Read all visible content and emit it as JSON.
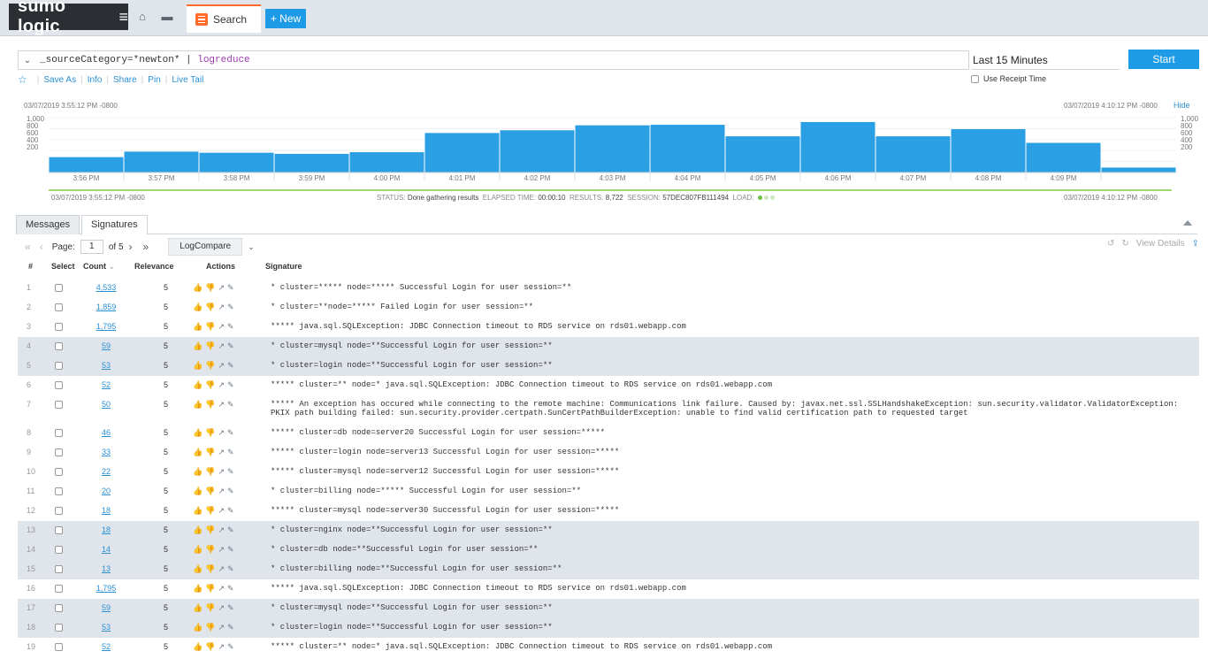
{
  "topbar": {
    "logo": "sumo logic",
    "search_tab": "Search",
    "new_button": "+ New"
  },
  "query": {
    "text": "_sourceCategory=*newton* | ",
    "keyword": "logreduce",
    "time_range": "Last 15 Minutes",
    "start_button": "Start",
    "use_receipt_time": "Use Receipt Time"
  },
  "actions": {
    "save_as": "Save As",
    "info": "Info",
    "share": "Share",
    "pin": "Pin",
    "live_tail": "Live Tail"
  },
  "histogram": {
    "ts_start": "03/07/2019 3:55:12 PM -0800",
    "ts_end": "03/07/2019 4:10:12 PM -0800",
    "hide": "Hide",
    "y_ticks": [
      "1,000",
      "800",
      "600",
      "400",
      "200"
    ],
    "time_labels": [
      "3:56 PM",
      "3:57 PM",
      "3:58 PM",
      "3:59 PM",
      "4:00 PM",
      "4:01 PM",
      "4:02 PM",
      "4:03 PM",
      "4:04 PM",
      "4:05 PM",
      "4:06 PM",
      "4:07 PM",
      "4:08 PM",
      "4:09 PM"
    ],
    "values": [
      280,
      380,
      360,
      340,
      370,
      720,
      770,
      860,
      870,
      660,
      920,
      660,
      790,
      540,
      90
    ]
  },
  "status": {
    "status_label": "STATUS:",
    "status_value": "Done gathering results",
    "elapsed_label": "ELAPSED TIME:",
    "elapsed_value": "00:00:10",
    "results_label": "RESULTS:",
    "results_value": "8,722",
    "session_label": "SESSION:",
    "session_value": "57DEC807FB111494",
    "load_label": "LOAD:"
  },
  "tabs": {
    "messages": "Messages",
    "signatures": "Signatures"
  },
  "pager": {
    "page_label": "Page:",
    "page_value": "1",
    "of_label": "of 5",
    "logcompare": "LogCompare",
    "view_details": "View Details"
  },
  "columns": {
    "num": "#",
    "select": "Select",
    "count": "Count",
    "relevance": "Relevance",
    "actions": "Actions",
    "signature": "Signature"
  },
  "rows": [
    {
      "n": "1",
      "count": "4,533",
      "rel": "5",
      "sig": "* cluster=***** node=***** Successful Login for user session=**",
      "hl": false
    },
    {
      "n": "2",
      "count": "1,859",
      "rel": "5",
      "sig": "* cluster=**node=***** Failed Login for user session=**",
      "hl": false
    },
    {
      "n": "3",
      "count": "1,795",
      "rel": "5",
      "sig": "***** java.sql.SQLException: JDBC Connection timeout to RDS service on rds01.webapp.com",
      "hl": false
    },
    {
      "n": "4",
      "count": "59",
      "rel": "5",
      "sig": "* cluster=mysql node=**Successful Login for user session=**",
      "hl": true
    },
    {
      "n": "5",
      "count": "53",
      "rel": "5",
      "sig": "* cluster=login node=**Successful Login for user session=**",
      "hl": true
    },
    {
      "n": "6",
      "count": "52",
      "rel": "5",
      "sig": "***** cluster=** node=* java.sql.SQLException: JDBC Connection timeout to RDS service on rds01.webapp.com",
      "hl": false
    },
    {
      "n": "7",
      "count": "50",
      "rel": "5",
      "sig": "***** An exception has occured while connecting to the remote machine: Communications link failure. Caused by: javax.net.ssl.SSLHandshakeException: sun.security.validator.ValidatorException: PKIX path building failed: sun.security.provider.certpath.SunCertPathBuilderException: unable to find valid certification path to requested target",
      "hl": false,
      "tall": true
    },
    {
      "n": "8",
      "count": "46",
      "rel": "5",
      "sig": "***** cluster=db node=server20 Successful Login for user session=*****",
      "hl": false
    },
    {
      "n": "9",
      "count": "33",
      "rel": "5",
      "sig": "***** cluster=login node=server13 Successful Login for user session=*****",
      "hl": false
    },
    {
      "n": "10",
      "count": "22",
      "rel": "5",
      "sig": "***** cluster=mysql node=server12 Successful Login for user session=*****",
      "hl": false
    },
    {
      "n": "11",
      "count": "20",
      "rel": "5",
      "sig": "* cluster=billing node=***** Successful Login for user session=**",
      "hl": false
    },
    {
      "n": "12",
      "count": "18",
      "rel": "5",
      "sig": "***** cluster=mysql node=server30 Successful Login for user session=*****",
      "hl": false
    },
    {
      "n": "13",
      "count": "18",
      "rel": "5",
      "sig": "* cluster=nginx node=**Successful Login for user session=**",
      "hl": true
    },
    {
      "n": "14",
      "count": "14",
      "rel": "5",
      "sig": "* cluster=db node=**Successful Login for user session=**",
      "hl": true
    },
    {
      "n": "15",
      "count": "13",
      "rel": "5",
      "sig": "* cluster=billing node=**Successful Login for user session=**",
      "hl": true
    },
    {
      "n": "16",
      "count": "1,795",
      "rel": "5",
      "sig": "***** java.sql.SQLException: JDBC Connection timeout to RDS service on rds01.webapp.com",
      "hl": false
    },
    {
      "n": "17",
      "count": "59",
      "rel": "5",
      "sig": "* cluster=mysql node=**Successful Login for user session=**",
      "hl": true
    },
    {
      "n": "18",
      "count": "53",
      "rel": "5",
      "sig": "* cluster=login node=**Successful Login for user session=**",
      "hl": true
    },
    {
      "n": "19",
      "count": "52",
      "rel": "5",
      "sig": "***** cluster=** node=* java.sql.SQLException: JDBC Connection timeout to RDS service on rds01.webapp.com",
      "hl": false
    }
  ]
}
